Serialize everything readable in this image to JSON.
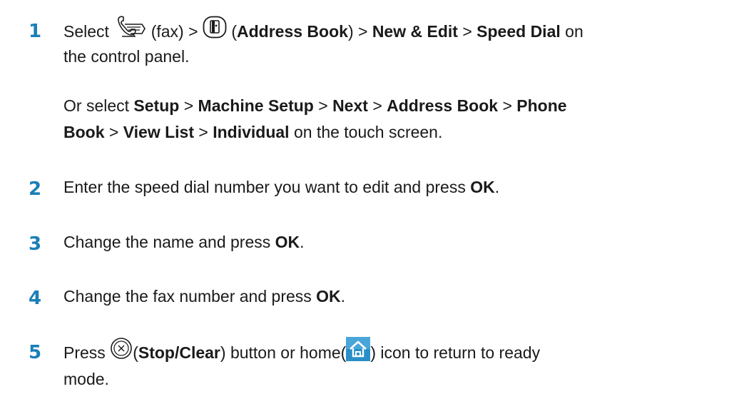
{
  "steps": [
    {
      "number": "1",
      "line1": {
        "select": "Select",
        "fax_icon": "fax-icon",
        "fax_text": "(fax) >",
        "address_book_icon": "address-book-icon",
        "open_paren": "(",
        "address_book": "Address Book",
        "close_sep": ") >",
        "new_edit": "New & Edit",
        "sep": ">",
        "speed_dial": "Speed Dial",
        "on": "on"
      },
      "line2": "the control panel.",
      "alt_line1": {
        "prefix": "Or select",
        "setup": "Setup",
        "sep1": ">",
        "machine_setup": "Machine Setup",
        "sep2": ">",
        "next": "Next",
        "sep3": ">",
        "address_book": "Address Book",
        "sep4": ">",
        "phone": "Phone"
      },
      "alt_line2": {
        "book": "Book",
        "sep1": ">",
        "view_list": "View List",
        "sep2": ">",
        "individual": "Individual",
        "suffix": "on the touch screen."
      }
    },
    {
      "number": "2",
      "text": "Enter the speed dial number you want to edit and press",
      "bold": "OK",
      "end": "."
    },
    {
      "number": "3",
      "text": "Change the name and press",
      "bold": "OK",
      "end": "."
    },
    {
      "number": "4",
      "text": "Change the fax number and press",
      "bold": "OK",
      "end": "."
    },
    {
      "number": "5",
      "press": "Press",
      "stop_icon": "stop-clear-icon",
      "open_paren": "(",
      "stop_clear": "Stop/Clear",
      "middle": ") button or home(",
      "home_icon": "home-icon",
      "end": ") icon to return to ready",
      "line2": "mode."
    }
  ],
  "colors": {
    "step_number": "#1a7fb8",
    "home_icon_bg": "#2a8fc7",
    "text": "#1a1a1a"
  }
}
